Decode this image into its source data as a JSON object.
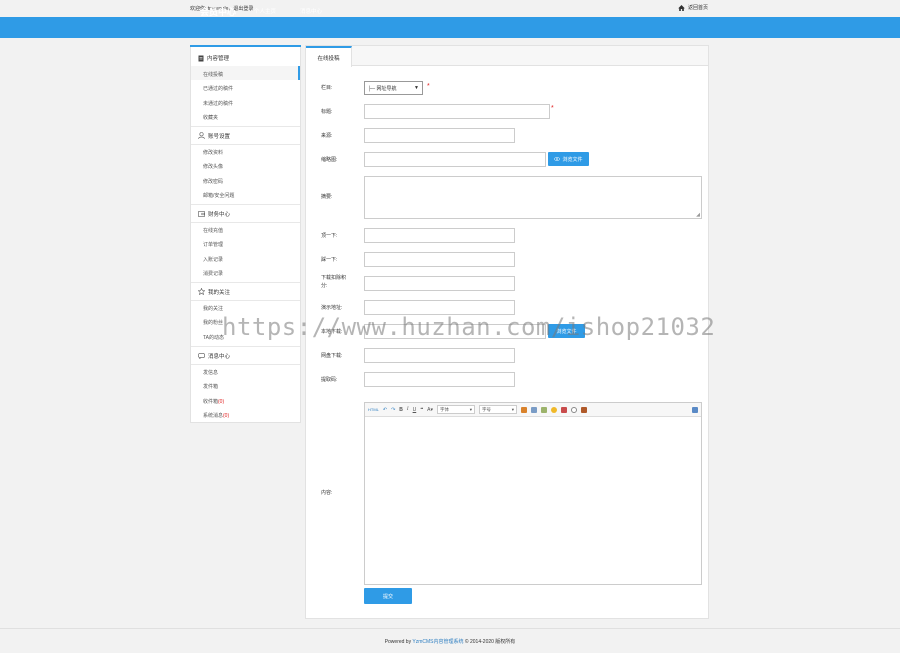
{
  "topbar": {
    "welcome_prefix": "欢迎你:",
    "username": "tmpeople",
    "separator": "，",
    "logout": "退出登录",
    "home_link": "返回首页",
    "home_icon": "home-icon"
  },
  "nav": {
    "brand": "会员中心",
    "links": [
      "个人主页",
      "消息中心"
    ]
  },
  "sidebar": {
    "sections": [
      {
        "title": "内容管理",
        "icon": "document-icon",
        "items": [
          "在线投稿",
          "已通过的稿件",
          "未通过的稿件",
          "收藏夹"
        ]
      },
      {
        "title": "账号设置",
        "icon": "user-icon",
        "items": [
          "修改资料",
          "修改头像",
          "修改密码",
          "邮箱/安全问题"
        ]
      },
      {
        "title": "财务中心",
        "icon": "wallet-icon",
        "items": [
          "在线充值",
          "订单管理",
          "入账记录",
          "消费记录"
        ]
      },
      {
        "title": "我的关注",
        "icon": "star-icon",
        "items": [
          "我的关注",
          "我的粉丝",
          "TA的动态"
        ]
      },
      {
        "title": "消息中心",
        "icon": "message-icon",
        "items": [
          "发信息",
          "发件箱",
          "收件箱",
          "系统消息"
        ]
      }
    ],
    "inbox_count": "(0)",
    "system_count": "(0)"
  },
  "form": {
    "tab": "在线投稿",
    "labels": {
      "column": "栏目:",
      "title": "标题:",
      "source": "来源:",
      "thumbnail": "缩略图:",
      "summary": "摘要:",
      "try1": "顶一下:",
      "try2": "踩一下:",
      "download_points_1": "下载扣除积",
      "download_points_2": "分:",
      "demo_url": "演示地址:",
      "local_download": "本地下载:",
      "netdisk_download": "网盘下载:",
      "extract_code": "提取码:",
      "content": "内容:"
    },
    "column_value": "├─ 网址导航",
    "required_mark": "*",
    "browse_button": "浏览文件",
    "submit_button": "提交",
    "editor": {
      "html_label": "HTML",
      "font_label": "字体",
      "size_label": "字号"
    }
  },
  "watermark": "https://www.huzhan.com/ishop21032",
  "footer": {
    "prefix": "Powered by",
    "product": "YzmCMS内容管理系统",
    "copyright": "© 2014-2020 版权所有"
  },
  "colors": {
    "accent": "#2f9be6",
    "required": "#e02020"
  }
}
